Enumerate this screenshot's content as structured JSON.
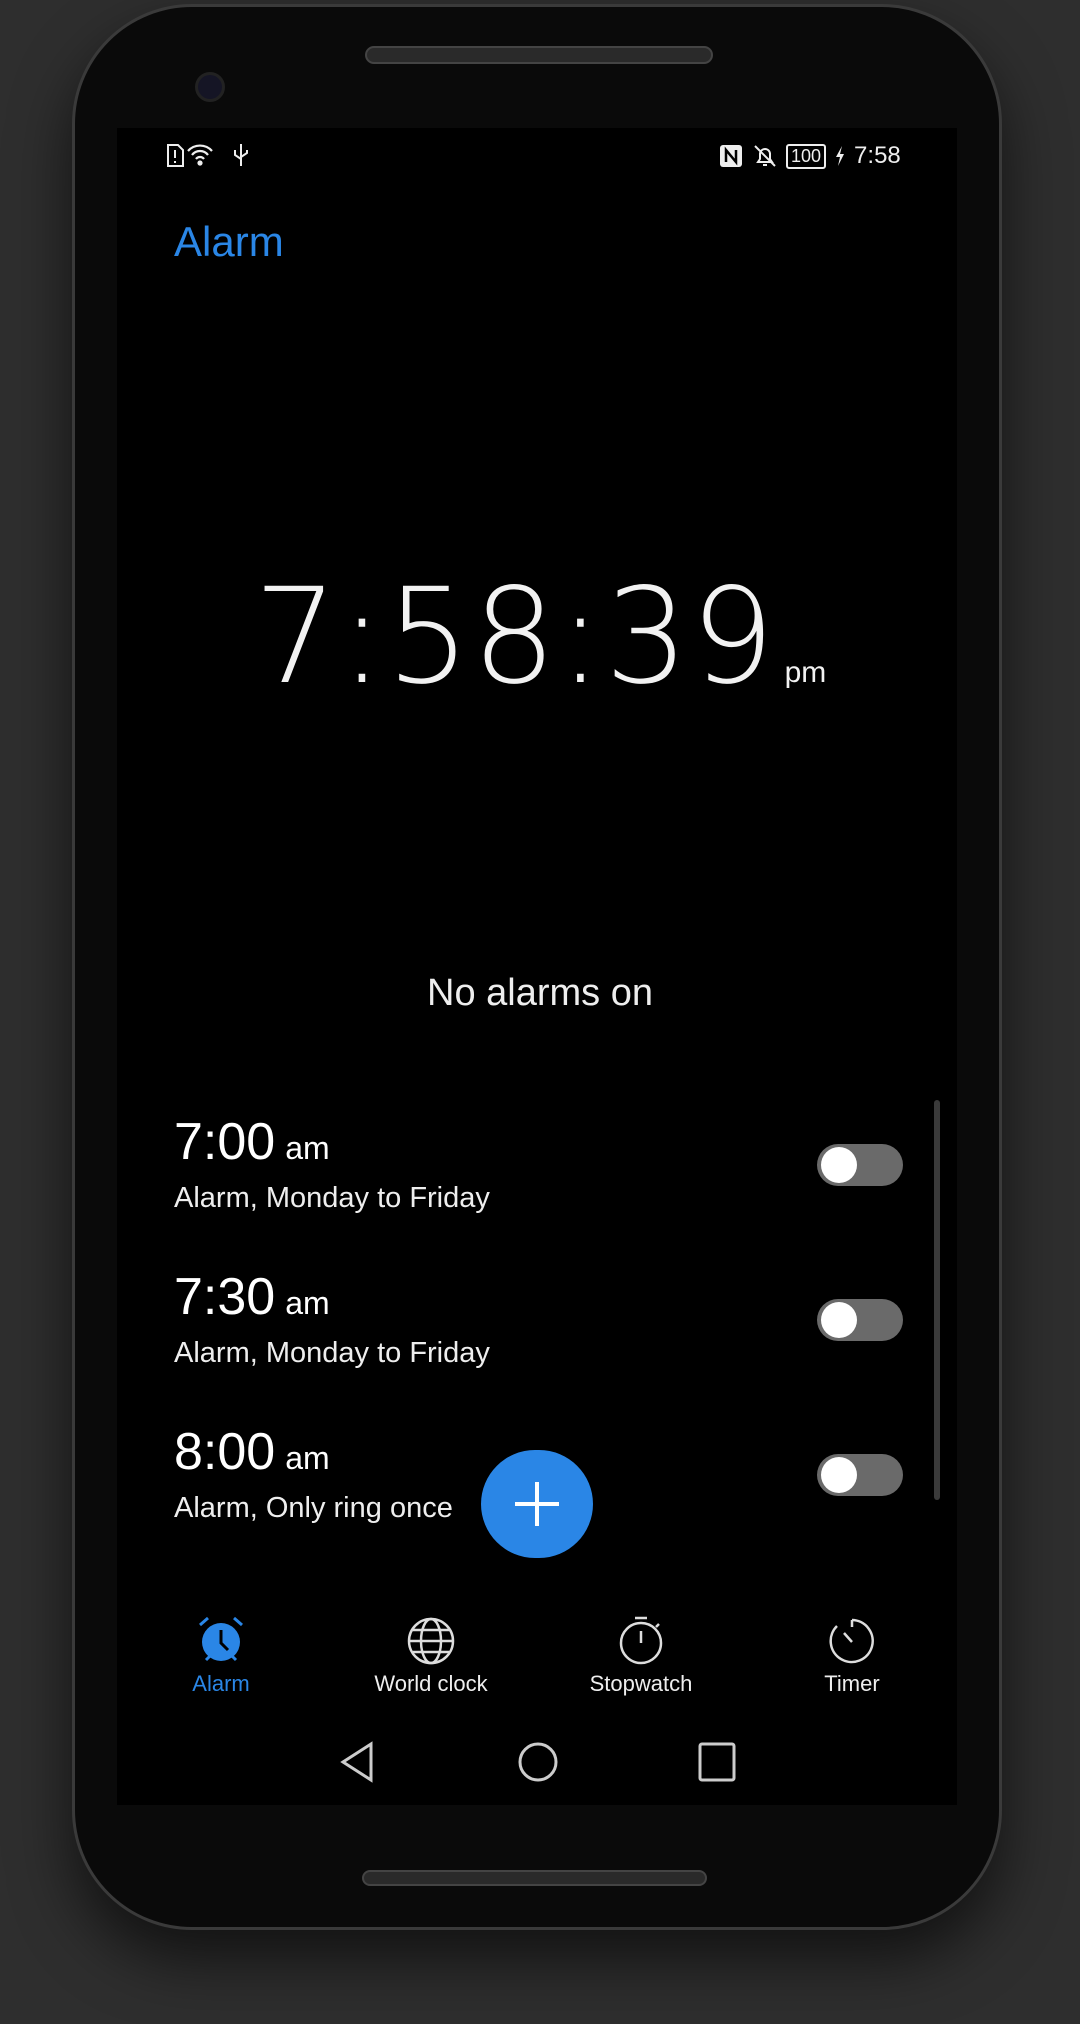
{
  "status_bar": {
    "left_icons": [
      "sim-alert-icon",
      "wifi-icon",
      "usb-icon"
    ],
    "right_icons": [
      "nfc-icon",
      "bell-off-icon"
    ],
    "battery": "100",
    "time": "7:58"
  },
  "header": {
    "title": "Alarm"
  },
  "clock": {
    "time": "7:58:39",
    "ampm": "pm"
  },
  "summary": "No alarms on",
  "alarms": [
    {
      "time": "7:00",
      "ampm": "am",
      "label": "Alarm, Monday to Friday",
      "enabled": false
    },
    {
      "time": "7:30",
      "ampm": "am",
      "label": "Alarm, Monday to Friday",
      "enabled": false
    },
    {
      "time": "8:00",
      "ampm": "am",
      "label": "Alarm, Only ring once",
      "enabled": false
    }
  ],
  "fab": {
    "icon": "plus-icon"
  },
  "tabs": [
    {
      "label": "Alarm",
      "icon": "alarm-clock-icon",
      "active": true
    },
    {
      "label": "World clock",
      "icon": "globe-icon",
      "active": false
    },
    {
      "label": "Stopwatch",
      "icon": "stopwatch-icon",
      "active": false
    },
    {
      "label": "Timer",
      "icon": "timer-icon",
      "active": false
    }
  ],
  "colors": {
    "accent": "#2a86e6",
    "background": "#000000",
    "toggle_off": "#6a6a6a"
  }
}
